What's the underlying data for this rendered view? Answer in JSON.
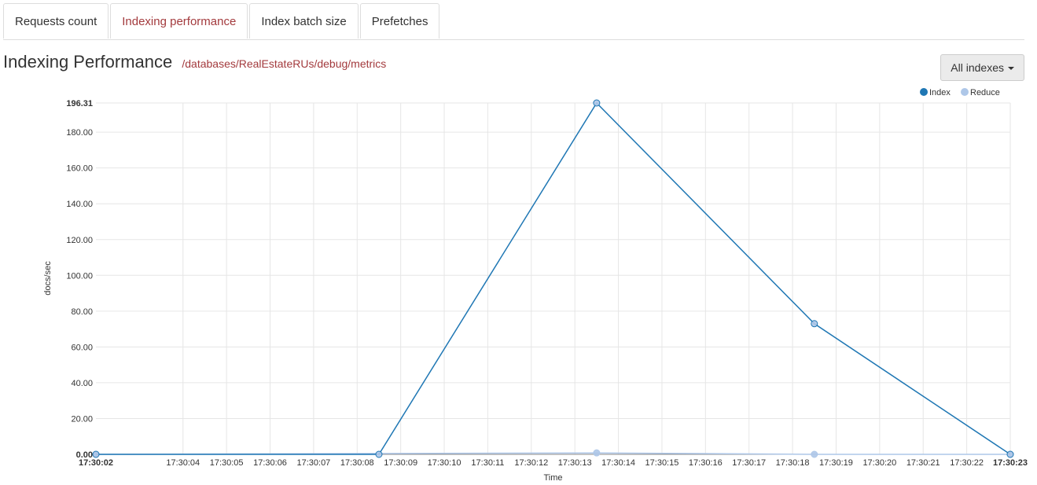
{
  "tabs": [
    {
      "label": "Requests count",
      "active": false
    },
    {
      "label": "Indexing performance",
      "active": true
    },
    {
      "label": "Index batch size",
      "active": false
    },
    {
      "label": "Prefetches",
      "active": false
    }
  ],
  "header": {
    "title": "Indexing Performance",
    "path": "/databases/RealEstateRUs/debug/metrics"
  },
  "dropdown": {
    "label": "All indexes"
  },
  "colors": {
    "accent": "#a33a3d",
    "index": "#1f77b4",
    "reduce": "#aec7e8",
    "grid": "#e6e6e6"
  },
  "chart_data": {
    "type": "line",
    "xlabel": "Time",
    "ylabel": "docs/sec",
    "ylim": [
      0,
      196.31
    ],
    "yticks": [
      "0.00",
      "20.00",
      "40.00",
      "60.00",
      "80.00",
      "100.00",
      "120.00",
      "140.00",
      "160.00",
      "180.00",
      "196.31"
    ],
    "xticks": [
      "17:30:02",
      "17:30:04",
      "17:30:05",
      "17:30:06",
      "17:30:07",
      "17:30:08",
      "17:30:09",
      "17:30:10",
      "17:30:11",
      "17:30:12",
      "17:30:13",
      "17:30:14",
      "17:30:15",
      "17:30:16",
      "17:30:17",
      "17:30:18",
      "17:30:19",
      "17:30:20",
      "17:30:21",
      "17:30:22",
      "17:30:23"
    ],
    "xlim": [
      "17:30:02",
      "17:30:23"
    ],
    "legend": "top-right",
    "grid": true,
    "series": [
      {
        "name": "Index",
        "color": "#1f77b4",
        "points": [
          [
            "17:30:02",
            0
          ],
          [
            "17:30:08.5",
            0
          ],
          [
            "17:30:13.5",
            196.31
          ],
          [
            "17:30:18.5",
            73
          ],
          [
            "17:30:23",
            0
          ]
        ]
      },
      {
        "name": "Reduce",
        "color": "#aec7e8",
        "points": [
          [
            "17:30:02",
            0
          ],
          [
            "17:30:13.5",
            0.8
          ],
          [
            "17:30:18.5",
            0
          ],
          [
            "17:30:23",
            0
          ]
        ]
      }
    ]
  }
}
